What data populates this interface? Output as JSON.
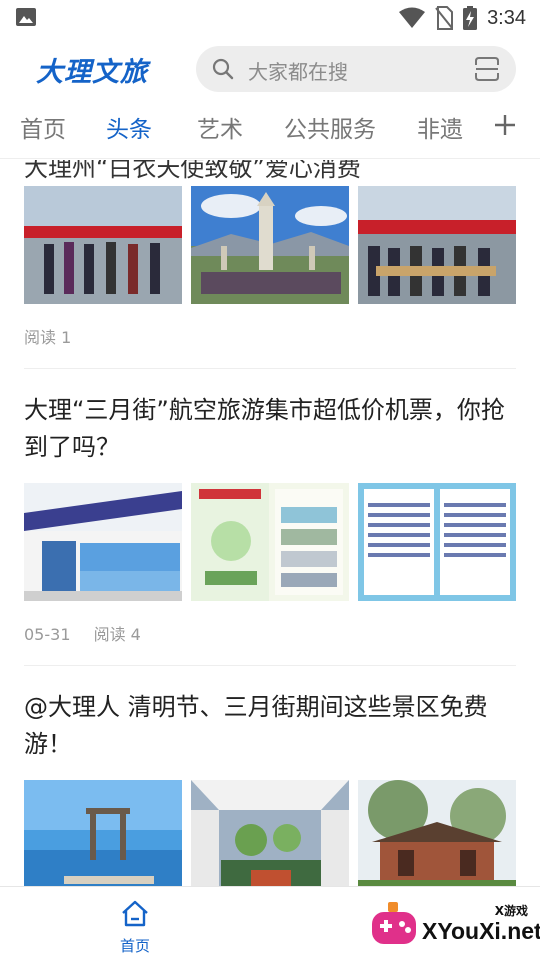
{
  "status_bar": {
    "time": "3:34",
    "icons": [
      "gallery-icon",
      "wifi-icon",
      "no-sim-icon",
      "battery-charging-icon"
    ]
  },
  "header": {
    "logo_text": "大理文旅",
    "search_placeholder": "大家都在搜",
    "icons": [
      "search-icon",
      "scan-icon"
    ]
  },
  "tabs": [
    {
      "label": "首页",
      "active": false
    },
    {
      "label": "头条",
      "active": true
    },
    {
      "label": "艺术",
      "active": false
    },
    {
      "label": "公共服务",
      "active": false
    },
    {
      "label": "非遗",
      "active": false
    }
  ],
  "feed": {
    "cut_off_title": "大理州“白衣天使致敬”爱心消费",
    "articles": [
      {
        "title": "",
        "date": "",
        "reads": "阅读 1"
      },
      {
        "title": "大理“三月街”航空旅游集市超低价机票，你抢到了吗？",
        "date": "05-31",
        "reads": "阅读 4"
      },
      {
        "title": "@大理人 清明节、三月街期间这些景区免费游！",
        "date": "",
        "reads": ""
      }
    ]
  },
  "bottom_nav": {
    "home_label": "首页"
  },
  "watermark": {
    "small": "X游戏",
    "main": "XYouXi.net"
  },
  "colors": {
    "accent": "#1463c8",
    "inactive_tab": "#777777",
    "meta_text": "#9a9a9a",
    "search_bg": "#ededed"
  }
}
